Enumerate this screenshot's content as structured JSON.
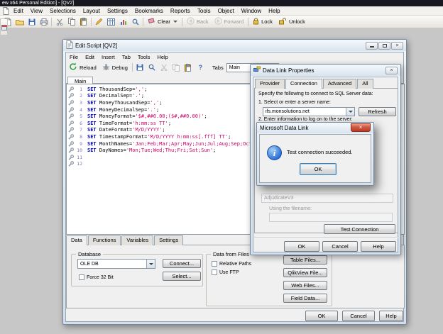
{
  "colors": {
    "keyword_blue": "#0000cc",
    "string_pink": "#cc0066",
    "line_number_purple": "#7d76b0",
    "titlebar_dark": "#181820",
    "msgbox_close_red": "#c23b2e",
    "info_icon_blue": "#2a6cd5"
  },
  "glyphs": {
    "close": "×",
    "help": "?"
  },
  "app": {
    "title": "ew x64 Personal Edition] - [QV2]",
    "menu": [
      "Edit",
      "View",
      "Selections",
      "Layout",
      "Settings",
      "Bookmarks",
      "Reports",
      "Tools",
      "Object",
      "Window",
      "Help"
    ],
    "toolbar": {
      "clear": "Clear",
      "back": "Back",
      "forward": "Forward",
      "lock": "Lock",
      "unlock": "Unlock"
    }
  },
  "edit_script": {
    "title": "Edit Script [QV2]",
    "menu": [
      "File",
      "Edit",
      "Insert",
      "Tab",
      "Tools",
      "Help"
    ],
    "toolbar": {
      "reload": "Reload",
      "debug": "Debug",
      "tabs_label": "Tabs",
      "tab_value": "Main"
    },
    "active_tab": "Main",
    "lines": [
      {
        "n": "1",
        "k": "SET",
        "c": "ThousandSep=",
        "s": "','",
        "e": ";"
      },
      {
        "n": "2",
        "k": "SET",
        "c": "DecimalSep=",
        "s": "'.'",
        "e": ";"
      },
      {
        "n": "3",
        "k": "SET",
        "c": "MoneyThousandSep=",
        "s": "','",
        "e": ";"
      },
      {
        "n": "4",
        "k": "SET",
        "c": "MoneyDecimalSep=",
        "s": "'.'",
        "e": ";"
      },
      {
        "n": "5",
        "k": "SET",
        "c": "MoneyFormat=",
        "s": "'$#,##0.00;($#,##0.00)'",
        "e": ";"
      },
      {
        "n": "6",
        "k": "SET",
        "c": "TimeFormat=",
        "s": "'h:mm:ss TT'",
        "e": ";"
      },
      {
        "n": "7",
        "k": "SET",
        "c": "DateFormat=",
        "s": "'M/D/YYYY'",
        "e": ";"
      },
      {
        "n": "8",
        "k": "SET",
        "c": "TimestampFormat=",
        "s": "'M/D/YYYY h:mm:ss[.fff] TT'",
        "e": ";"
      },
      {
        "n": "9",
        "k": "SET",
        "c": "MonthNames=",
        "s": "'Jan;Feb;Mar;Apr;May;Jun;Jul;Aug;Sep;Oct;Nov;Dec'",
        "e": ";"
      },
      {
        "n": "10",
        "k": "SET",
        "c": "DayNames=",
        "s": "'Mon;Tue;Wed;Thu;Fri;Sat;Sun'",
        "e": ";"
      },
      {
        "n": "11",
        "k": "",
        "c": "",
        "s": "",
        "e": ""
      },
      {
        "n": "12",
        "k": "",
        "c": "",
        "s": "",
        "e": ""
      }
    ],
    "panel_tabs": [
      "Data",
      "Functions",
      "Variables",
      "Settings"
    ],
    "database_group": {
      "label": "Database",
      "value": "OLE DB",
      "connect": "Connect...",
      "select": "Select...",
      "force32": "Force 32 Bit"
    },
    "files_group": {
      "label": "Data from Files",
      "relative_paths": "Relative Paths",
      "use_ftp": "Use FTP",
      "table_files": "Table Files...",
      "qlikview_file": "QlikView File...",
      "web_files": "Web Files...",
      "field_data": "Field Data..."
    },
    "ok": "OK",
    "cancel": "Cancel",
    "help": "Help"
  },
  "data_link": {
    "title": "Data Link Properties",
    "tabs": [
      "Provider",
      "Connection",
      "Advanced",
      "All"
    ],
    "intro": "Specify the following to connect to SQL Server data:",
    "step1": "1. Select or enter a server name:",
    "server": "ifs.monsolutions.net",
    "refresh": "Refresh",
    "step2": "2. Enter information to log on to the server:",
    "database_value": "AdjudicateV3",
    "using_filename": "Using the filename:",
    "test_connection": "Test Connection",
    "ok": "OK",
    "cancel": "Cancel",
    "help": "Help"
  },
  "msgbox": {
    "title": "Microsoft Data Link",
    "message": "Test connection succeeded.",
    "ok": "OK"
  }
}
